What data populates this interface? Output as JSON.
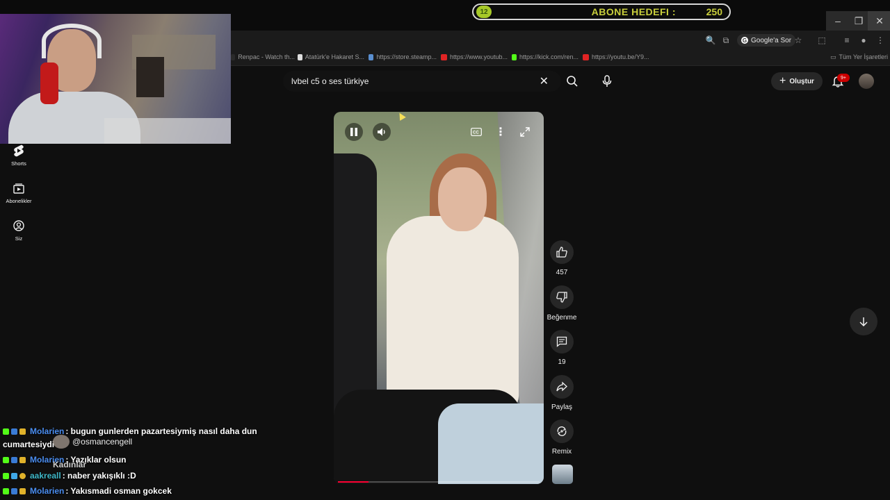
{
  "stream_overlay": {
    "goal_level": "12",
    "goal_label": "ABONE HEDEFI :",
    "goal_count": "250"
  },
  "browser": {
    "google_ask": "Google'a Sor",
    "bookmarks": [
      {
        "label": "Renpac - Watch th...",
        "color": "#2a2a2a"
      },
      {
        "label": "Atatürk'e Hakaret S...",
        "color": "#dddddd"
      },
      {
        "label": "https://store.steamp...",
        "color": "#5a8fd0"
      },
      {
        "label": "https://www.youtub...",
        "color": "#e02424"
      },
      {
        "label": "https://kick.com/ren...",
        "color": "#53fc18"
      },
      {
        "label": "https://youtu.be/Y9...",
        "color": "#e02424"
      }
    ],
    "all_bookmarks": "Tüm Yer İşaretleri"
  },
  "nav": {
    "items": [
      {
        "label": "Shorts",
        "icon": "shorts-icon"
      },
      {
        "label": "Abonelikler",
        "icon": "subscriptions-icon"
      },
      {
        "label": "Siz",
        "icon": "you-icon"
      }
    ]
  },
  "search": {
    "value": "lvbel c5 o ses türkiye"
  },
  "header": {
    "create_label": "Oluştur",
    "notifications": "9+"
  },
  "video": {
    "progress": 0.15
  },
  "actions": {
    "like_count": "457",
    "dislike_label": "Beğenme",
    "comment_count": "19",
    "share_label": "Paylaş",
    "remix_label": "Remix"
  },
  "chat": {
    "messages": [
      {
        "user": "Molarien",
        "text": " : bugun gunlerden pazartesiymiş nasıl daha dun"
      },
      {
        "user": "",
        "text": "cumartesiydi"
      },
      {
        "user": "Molarien",
        "text": " : Yazıklar olsun"
      },
      {
        "user": "aakreall",
        "text": " : naber yakışıklı :D"
      },
      {
        "user": "Molarien",
        "text": " : Yakısmadi osman gokcek"
      }
    ],
    "mention": "@osmancengell",
    "overlay_text": "Kadınlar"
  },
  "colors": {
    "accent": "#ff0033",
    "goal_text": "#c9cf3c",
    "chat_user_blue": "#4a8df0"
  }
}
